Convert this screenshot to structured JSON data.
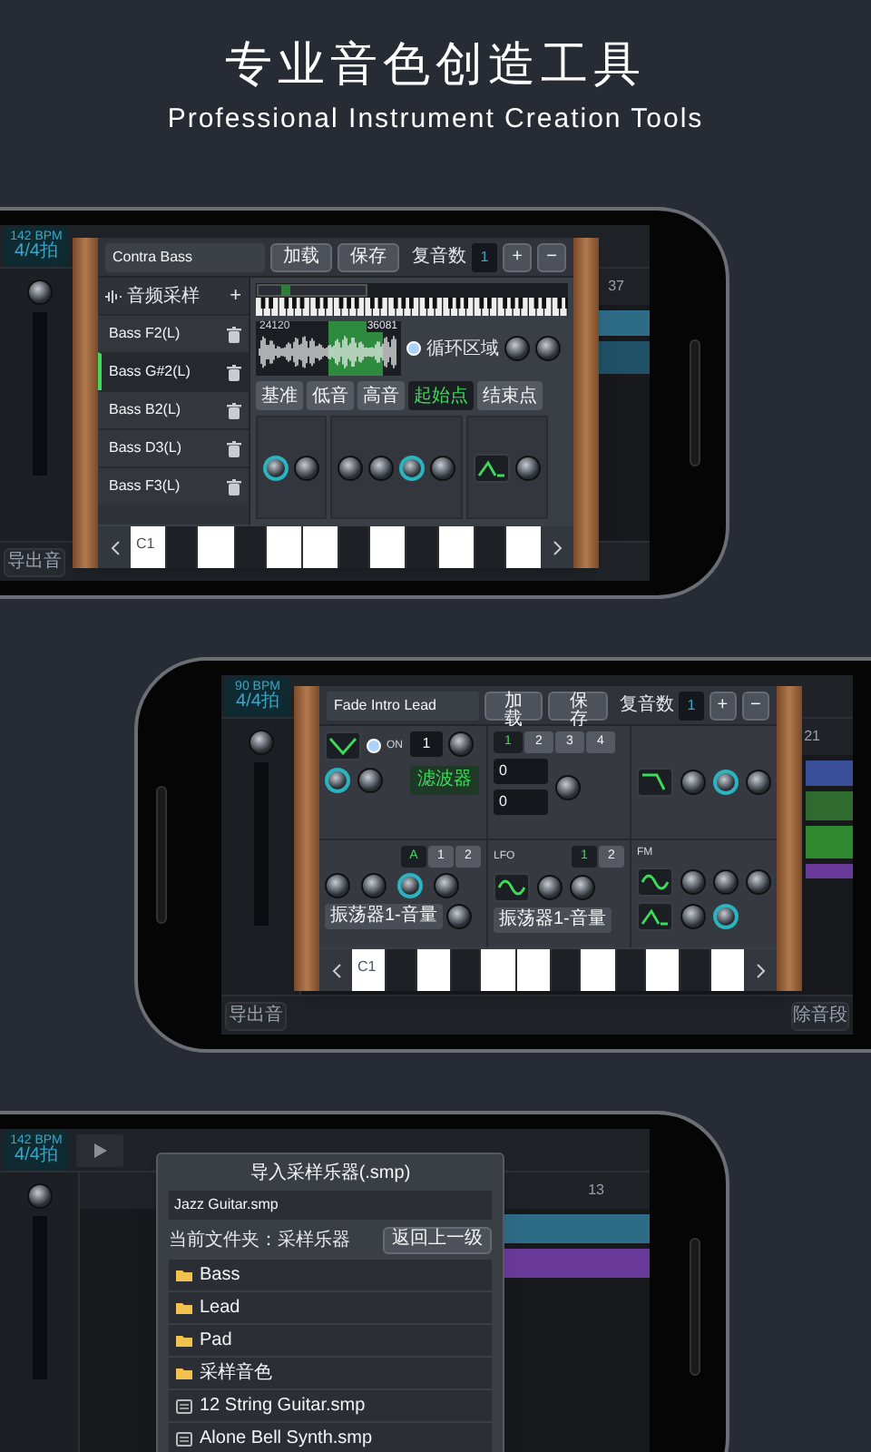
{
  "header": {
    "title": "专业音色创造工具",
    "subtitle": "Professional Instrument Creation Tools"
  },
  "phone_1": {
    "daw": {
      "tempo": "142 BPM",
      "meter": "4/4拍",
      "bar_number": "37",
      "export_button": "导出音"
    },
    "sampler": {
      "preset_name": "Contra Bass",
      "load_button": "加载",
      "save_button": "保存",
      "polyphony_label": "复音数",
      "polyphony_value": "1",
      "add_button": "+",
      "remove_button": "−",
      "list_header": "音频采样",
      "list_add": "+",
      "samples": [
        {
          "name": "Bass F2(L)",
          "selected": false
        },
        {
          "name": "Bass G#2(L)",
          "selected": true
        },
        {
          "name": "Bass B2(L)",
          "selected": false
        },
        {
          "name": "Bass D3(L)",
          "selected": false
        },
        {
          "name": "Bass F3(L)",
          "selected": false
        }
      ],
      "wave_start": "24120",
      "wave_end": "36081",
      "loop": {
        "label": "循环区域",
        "on": true
      },
      "mode_tabs": [
        {
          "label": "基准",
          "selected": false
        },
        {
          "label": "低音",
          "selected": false
        },
        {
          "label": "高音",
          "selected": false
        },
        {
          "label": "起始点",
          "selected": true
        },
        {
          "label": "结束点",
          "selected": false
        }
      ],
      "keyboard_first": "C1"
    }
  },
  "phone_2": {
    "daw": {
      "tempo": "90 BPM",
      "meter": "4/4拍",
      "bar_number": "21",
      "export_button": "导出音",
      "delete_button": "除音段"
    },
    "synth": {
      "preset_name": "Fade Intro Lead",
      "load_button": "加载",
      "save_button": "保存",
      "polyphony_label": "复音数",
      "polyphony_value": "1",
      "add_button": "+",
      "remove_button": "−",
      "osc_power": {
        "label": "ON",
        "on": true
      },
      "osc_step": "1",
      "filter_button": "滤波器",
      "osc_tabs": [
        {
          "label": "1",
          "selected": true
        },
        {
          "label": "2",
          "selected": false
        },
        {
          "label": "3",
          "selected": false
        },
        {
          "label": "4",
          "selected": false
        }
      ],
      "step_values": [
        "0",
        "0"
      ],
      "env_tabs": [
        {
          "label": "A",
          "selected": true
        },
        {
          "label": "1",
          "selected": false
        },
        {
          "label": "2",
          "selected": false
        }
      ],
      "lfo_label": "LFO",
      "lfo_tabs": [
        {
          "label": "1",
          "selected": true
        },
        {
          "label": "2",
          "selected": false
        }
      ],
      "dropdowns": [
        "振荡器1-音量",
        "振荡器1-音量"
      ],
      "fm_label": "FM",
      "keyboard_first": "C1"
    }
  },
  "phone_3": {
    "daw": {
      "tempo": "142 BPM",
      "meter": "4/4拍",
      "bar_number": "13"
    },
    "import_dialog": {
      "title": "导入采样乐器(.smp)",
      "file_name": "Jazz Guitar.smp",
      "folder_label": "当前文件夹：采样乐器",
      "back_button": "返回上一级",
      "entries": [
        {
          "kind": "folder",
          "name": "Bass"
        },
        {
          "kind": "folder",
          "name": "Lead"
        },
        {
          "kind": "folder",
          "name": "Pad"
        },
        {
          "kind": "folder",
          "name": "采样音色"
        },
        {
          "kind": "file",
          "name": "12 String Guitar.smp"
        },
        {
          "kind": "file",
          "name": "Alone Bell Synth.smp"
        }
      ]
    }
  }
}
